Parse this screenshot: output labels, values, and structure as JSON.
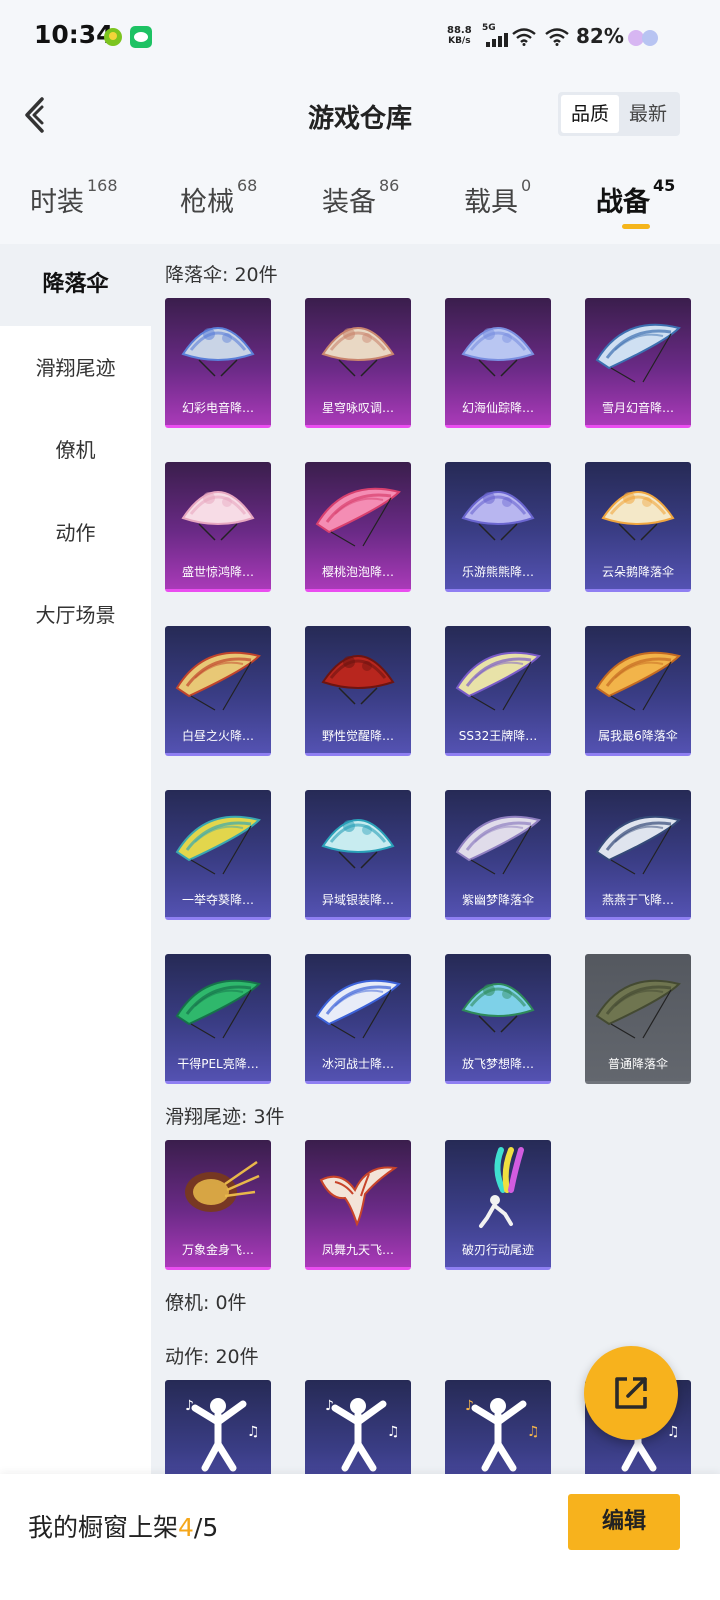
{
  "status_bar": {
    "time": "10:34",
    "net_speed_value": "88.8",
    "net_speed_unit": "KB/s",
    "network": "5G",
    "battery": "82%",
    "app_icons": [
      "xbox-like-app-icon",
      "wechat-icon"
    ]
  },
  "header": {
    "title": "游戏仓库",
    "sort_options": [
      {
        "label": "品质",
        "active": true
      },
      {
        "label": "最新",
        "active": false
      }
    ]
  },
  "tabs": [
    {
      "label": "时装",
      "count": "168",
      "active": false
    },
    {
      "label": "枪械",
      "count": "68",
      "active": false
    },
    {
      "label": "装备",
      "count": "86",
      "active": false
    },
    {
      "label": "载具",
      "count": "0",
      "active": false
    },
    {
      "label": "战备",
      "count": "45",
      "active": true
    }
  ],
  "sidebar": [
    {
      "label": "降落伞",
      "active": true
    },
    {
      "label": "滑翔尾迹",
      "active": false
    },
    {
      "label": "僚机",
      "active": false
    },
    {
      "label": "动作",
      "active": false
    },
    {
      "label": "大厅场景",
      "active": false
    }
  ],
  "sections": [
    {
      "title": "降落伞: 20件",
      "items": [
        {
          "name": "幻彩电音降…",
          "rarity": "purple",
          "art": "parachute-round",
          "colors": [
            "#c9d4e6",
            "#5b7fd8"
          ]
        },
        {
          "name": "星穹咏叹调…",
          "rarity": "purple",
          "art": "parachute-round",
          "colors": [
            "#e9d8c4",
            "#c9856e"
          ]
        },
        {
          "name": "幻海仙踪降…",
          "rarity": "purple",
          "art": "parachute-round",
          "colors": [
            "#b9c6f2",
            "#7a8fe0"
          ]
        },
        {
          "name": "雪月幻音降…",
          "rarity": "purple",
          "art": "parachute-wing",
          "colors": [
            "#cfe0f2",
            "#3d6fb0"
          ]
        },
        {
          "name": "盛世惊鸿降…",
          "rarity": "purple",
          "art": "parachute-round",
          "colors": [
            "#f7dce6",
            "#e7a7c0"
          ]
        },
        {
          "name": "樱桃泡泡降…",
          "rarity": "purple",
          "art": "parachute-wing",
          "colors": [
            "#f48db4",
            "#d8406e"
          ]
        },
        {
          "name": "乐游熊熊降…",
          "rarity": "blue",
          "art": "parachute-round",
          "colors": [
            "#b8b6f0",
            "#6b66d0"
          ]
        },
        {
          "name": "云朵鹅降落伞",
          "rarity": "blue",
          "art": "parachute-round",
          "colors": [
            "#f4e8c8",
            "#f0a640"
          ]
        },
        {
          "name": "白昼之火降…",
          "rarity": "blue",
          "art": "parachute-wing",
          "colors": [
            "#e8c876",
            "#c0442c"
          ]
        },
        {
          "name": "野性觉醒降…",
          "rarity": "blue",
          "art": "parachute-round",
          "colors": [
            "#b8261e",
            "#6e1410"
          ]
        },
        {
          "name": "SS32王牌降…",
          "rarity": "blue",
          "art": "parachute-wing",
          "colors": [
            "#e8e2a8",
            "#7a5cc8"
          ]
        },
        {
          "name": "属我最6降落伞",
          "rarity": "blue",
          "art": "parachute-wing",
          "colors": [
            "#f2b44a",
            "#c46a22"
          ]
        },
        {
          "name": "一举夺葵降…",
          "rarity": "blue",
          "art": "parachute-wing",
          "colors": [
            "#e2d64c",
            "#3aa8b0"
          ]
        },
        {
          "name": "异域银装降…",
          "rarity": "blue",
          "art": "parachute-round",
          "colors": [
            "#c8ecf0",
            "#2aa0b8"
          ]
        },
        {
          "name": "紫幽梦降落伞",
          "rarity": "blue",
          "art": "parachute-wing",
          "colors": [
            "#e0dcea",
            "#8f7fc0"
          ]
        },
        {
          "name": "燕燕于飞降…",
          "rarity": "blue",
          "art": "parachute-wing",
          "colors": [
            "#dfe4ee",
            "#354a78"
          ]
        },
        {
          "name": "干得PEL亮降…",
          "rarity": "blue",
          "art": "parachute-wing",
          "colors": [
            "#2fb86c",
            "#16724a"
          ]
        },
        {
          "name": "冰河战士降…",
          "rarity": "blue",
          "art": "parachute-wing",
          "colors": [
            "#e8ecf8",
            "#3c62d8"
          ]
        },
        {
          "name": "放飞梦想降…",
          "rarity": "blue",
          "art": "parachute-round",
          "colors": [
            "#7ed1e8",
            "#2e8a5a"
          ]
        },
        {
          "name": "普通降落伞",
          "rarity": "grey",
          "art": "parachute-wing",
          "colors": [
            "#6f7550",
            "#444a32"
          ]
        }
      ]
    },
    {
      "title": "滑翔尾迹: 3件",
      "items": [
        {
          "name": "万象金身飞…",
          "rarity": "purple",
          "art": "trail-burst",
          "colors": [
            "#e8b84a",
            "#7a3a1a"
          ]
        },
        {
          "name": "凤舞九天飞…",
          "rarity": "purple",
          "art": "trail-phoenix",
          "colors": [
            "#f3e4d8",
            "#c8442a"
          ]
        },
        {
          "name": "破刃行动尾迹",
          "rarity": "blue",
          "art": "trail-smoke",
          "colors": [
            "#f2f2f2",
            "#d25ce0"
          ]
        }
      ]
    },
    {
      "title": "僚机: 0件",
      "items": []
    },
    {
      "title": "动作: 20件",
      "items": [
        {
          "name": "",
          "rarity": "blue",
          "art": "emote-dance",
          "colors": [
            "#ffffff",
            "#ffffff"
          ]
        },
        {
          "name": "",
          "rarity": "blue",
          "art": "emote-dab",
          "colors": [
            "#ffffff",
            "#ffffff"
          ]
        },
        {
          "name": "",
          "rarity": "blue",
          "art": "emote-jump",
          "colors": [
            "#ffffff",
            "#f3b44a"
          ]
        },
        {
          "name": "",
          "rarity": "blue",
          "art": "emote-dance",
          "colors": [
            "#ffffff",
            "#ffffff"
          ]
        }
      ]
    }
  ],
  "bottom_bar": {
    "label": "我的橱窗上架",
    "shelf_count": "4",
    "shelf_total": "/5",
    "edit_label": "编辑"
  },
  "fab_icon": "share-external-icon"
}
